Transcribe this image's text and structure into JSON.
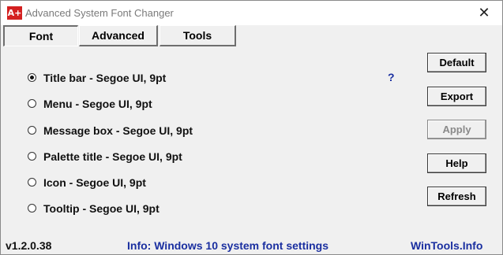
{
  "window": {
    "title": "Advanced System Font Changer",
    "icon_label": "A+",
    "close_glyph": "✕"
  },
  "tabs": [
    {
      "label": "Font",
      "active": true
    },
    {
      "label": "Advanced",
      "active": false
    },
    {
      "label": "Tools",
      "active": false
    }
  ],
  "fonts": [
    {
      "label": "Title bar - Segoe UI, 9pt",
      "selected": true
    },
    {
      "label": "Menu - Segoe UI, 9pt",
      "selected": false
    },
    {
      "label": "Message box - Segoe UI, 9pt",
      "selected": false
    },
    {
      "label": "Palette title - Segoe UI, 9pt",
      "selected": false
    },
    {
      "label": "Icon - Segoe UI, 9pt",
      "selected": false
    },
    {
      "label": "Tooltip - Segoe UI, 9pt",
      "selected": false
    }
  ],
  "help_marker": "?",
  "buttons": {
    "default": "Default",
    "export": "Export",
    "apply": "Apply",
    "help": "Help",
    "refresh": "Refresh"
  },
  "status": {
    "version": "v1.2.0.38",
    "info": "Info: Windows 10 system font settings",
    "site": "WinTools.Info"
  },
  "colors": {
    "accent_link": "#1a2fa0",
    "icon_red": "#d42020"
  }
}
